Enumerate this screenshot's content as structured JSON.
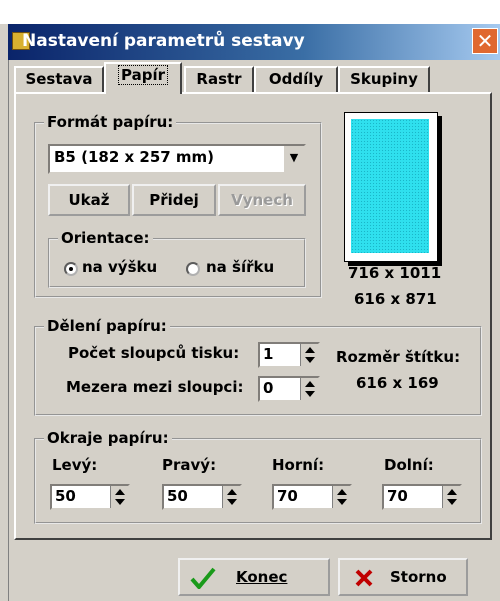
{
  "window": {
    "title": "Nastavení parametrů sestavy",
    "close_glyph": "✕"
  },
  "tabs": [
    "Sestava",
    "Papír",
    "Rastr",
    "Oddíly",
    "Skupiny"
  ],
  "active_tab": "Papír",
  "format": {
    "group_title": "Formát papíru:",
    "selected": "B5 (182 x 257 mm)",
    "buttons": {
      "show": "Ukaž",
      "add": "Přidej",
      "remove": "Vynech"
    },
    "orientation": {
      "title": "Orientace:",
      "portrait": "na výšku",
      "landscape": "na šířku",
      "selected": "portrait"
    }
  },
  "preview": {
    "size1": "716 x 1011",
    "size2": "616 x 871"
  },
  "division": {
    "group_title": "Dělení papíru:",
    "columns_label": "Počet sloupců tisku:",
    "columns_value": "1",
    "gap_label": "Mezera mezi sloupci:",
    "gap_value": "0",
    "label_size_title": "Rozměr štítku:",
    "label_size_value": "616 x 169"
  },
  "margins": {
    "group_title": "Okraje papíru:",
    "left_label": "Levý:",
    "left_value": "50",
    "right_label": "Pravý:",
    "right_value": "50",
    "top_label": "Horní:",
    "top_value": "70",
    "bottom_label": "Dolní:",
    "bottom_value": "70"
  },
  "footer": {
    "ok_label": "Konec",
    "cancel_label": "Storno"
  },
  "colors": {
    "title_bar": "#0a246a",
    "face": "#d4d0c8",
    "preview_fill": "#2fe0ee",
    "check": "#1a9a1a",
    "cancel_x": "#c00000"
  }
}
